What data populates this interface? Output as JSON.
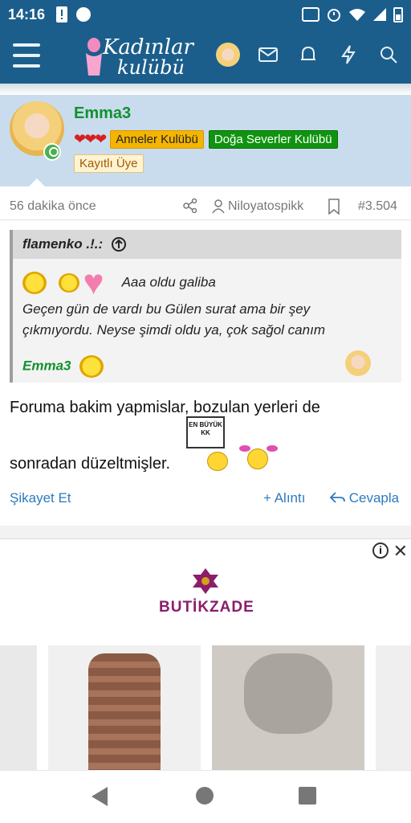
{
  "status_bar": {
    "time": "14:16",
    "icons": [
      "warning-icon",
      "circle-icon",
      "volte-icon",
      "alarm-icon",
      "wifi-icon",
      "signal-icon",
      "battery-icon"
    ]
  },
  "header": {
    "logo_line1": "Kadınlar",
    "logo_line2": "kulübü",
    "icons": [
      "menu-icon",
      "mail-icon",
      "bell-icon",
      "bolt-icon",
      "search-icon"
    ]
  },
  "post": {
    "username": "Emma3",
    "badges": [
      "Anneler Kulübü",
      "Doğa Severler Kulübü"
    ],
    "member_badge": "Kayıtlı Üye",
    "time_ago": "56 dakika önce",
    "user_link": "Niloyatospikk",
    "post_number": "#3.504",
    "quote": {
      "author": "flamenko .!.:",
      "line1": "Aaa oldu galiba",
      "line2": "Geçen gün de vardı bu Gülen surat ama bir şey",
      "line3": "çıkmıyordu. Neyse şimdi oldu ya, çok sağol canım",
      "signature": "Emma3"
    },
    "text_line1": "Foruma bakim yapmislar, bozulan yerleri de",
    "text_line2": "sonradan düzeltmişler.",
    "sign_text": "EN BÜYÜK KK",
    "actions": {
      "report": "Şikayet Et",
      "quote": "+ Alıntı",
      "reply": "Cevapla"
    }
  },
  "ad": {
    "brand": "BUTİKZADE",
    "info": "i",
    "close": "✕"
  },
  "colors": {
    "header_bg": "#1b5e8c",
    "username_green": "#119130",
    "link_blue": "#2c7bc0"
  }
}
